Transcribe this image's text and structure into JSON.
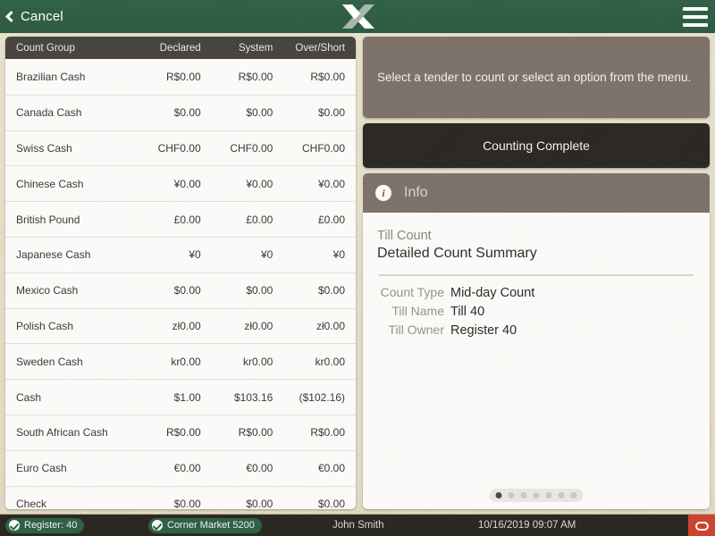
{
  "header": {
    "cancel_label": "Cancel",
    "brand_logo_icon": "x-logo-icon",
    "menu_icon": "hamburger-menu-icon",
    "back_icon": "chevron-left-icon",
    "brand_color": "#2f6145"
  },
  "table": {
    "columns": [
      "Count Group",
      "Declared",
      "System",
      "Over/Short"
    ],
    "rows": [
      {
        "group": "Brazilian Cash",
        "declared": "R$0.00",
        "system": "R$0.00",
        "over_short": "R$0.00"
      },
      {
        "group": "Canada Cash",
        "declared": "$0.00",
        "system": "$0.00",
        "over_short": "$0.00"
      },
      {
        "group": "Swiss Cash",
        "declared": "CHF0.00",
        "system": "CHF0.00",
        "over_short": "CHF0.00"
      },
      {
        "group": "Chinese Cash",
        "declared": "¥0.00",
        "system": "¥0.00",
        "over_short": "¥0.00"
      },
      {
        "group": "British Pound",
        "declared": "£0.00",
        "system": "£0.00",
        "over_short": "£0.00"
      },
      {
        "group": "Japanese Cash",
        "declared": "¥0",
        "system": "¥0",
        "over_short": "¥0"
      },
      {
        "group": "Mexico Cash",
        "declared": "$0.00",
        "system": "$0.00",
        "over_short": "$0.00"
      },
      {
        "group": "Polish Cash",
        "declared": "zł0.00",
        "system": "zł0.00",
        "over_short": "zł0.00"
      },
      {
        "group": "Sweden Cash",
        "declared": "kr0.00",
        "system": "kr0.00",
        "over_short": "kr0.00"
      },
      {
        "group": "Cash",
        "declared": "$1.00",
        "system": "$103.16",
        "over_short": "($102.16)"
      },
      {
        "group": "South African Cash",
        "declared": "R$0.00",
        "system": "R$0.00",
        "over_short": "R$0.00"
      },
      {
        "group": "Euro Cash",
        "declared": "€0.00",
        "system": "€0.00",
        "over_short": "€0.00"
      },
      {
        "group": "Check",
        "declared": "$0.00",
        "system": "$0.00",
        "over_short": "$0.00"
      }
    ]
  },
  "right": {
    "prompt": "Select a tender to count or select an option from the menu.",
    "counting_complete_label": "Counting Complete",
    "info_title": "Info",
    "info_icon": "info-circle-icon",
    "summary": {
      "kicker": "Till Count",
      "title": "Detailed Count Summary",
      "fields": [
        {
          "label": "Count Type",
          "value": "Mid-day Count"
        },
        {
          "label": "Till Name",
          "value": "Till 40"
        },
        {
          "label": "Till Owner",
          "value": "Register 40"
        }
      ]
    },
    "pager": {
      "total": 7,
      "active_index": 0
    }
  },
  "statusbar": {
    "register": "Register: 40",
    "store": "Corner Market 5200",
    "user": "John Smith",
    "datetime": "10/16/2019 09:07 AM",
    "power_icon": "power-button-icon",
    "power_color": "#cb4430"
  }
}
